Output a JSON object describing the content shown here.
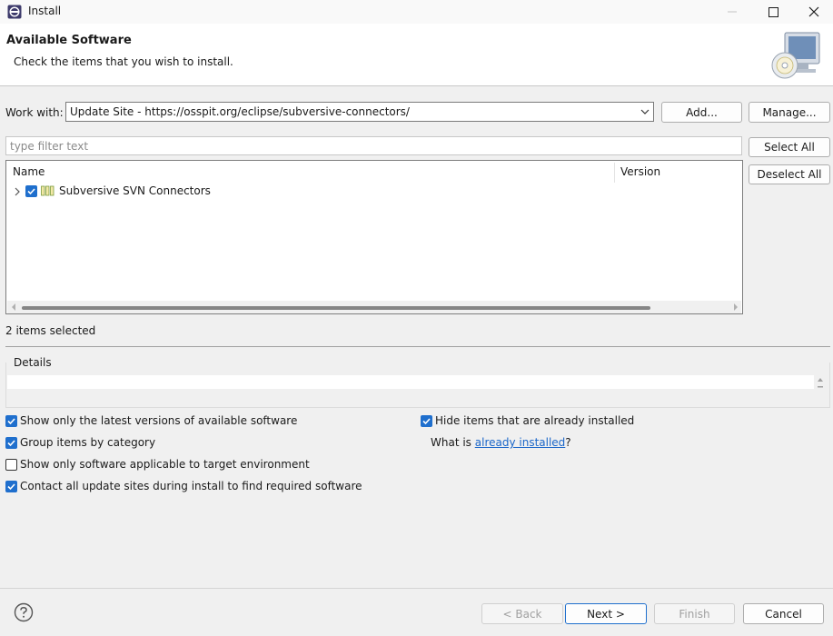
{
  "window": {
    "title": "Install",
    "icons": {
      "app": "eclipse-icon",
      "minimize": "minimize-icon",
      "maximize": "maximize-icon",
      "close": "close-icon"
    }
  },
  "header": {
    "title": "Available Software",
    "subtitle": "Check the items that you wish to install.",
    "image": "install-wizard-banner-icon"
  },
  "work_with": {
    "label": "Work with:",
    "value": "Update Site - https://osspit.org/eclipse/subversive-connectors/",
    "add_label": "Add...",
    "manage_label": "Manage..."
  },
  "filter": {
    "placeholder": "type filter text"
  },
  "selection_buttons": {
    "select_all": "Select All",
    "deselect_all": "Deselect All"
  },
  "table": {
    "columns": [
      "Name",
      "Version"
    ],
    "rows": [
      {
        "name": "Subversive SVN Connectors",
        "version": "",
        "checked": true,
        "expandable": true,
        "icon": "category-icon"
      }
    ]
  },
  "status": "2 items selected",
  "details": {
    "label": "Details",
    "text": ""
  },
  "options": {
    "latest": {
      "label": "Show only the latest versions of available software",
      "checked": true
    },
    "group": {
      "label": "Group items by category",
      "checked": true
    },
    "target": {
      "label": "Show only software applicable to target environment",
      "checked": false
    },
    "contact": {
      "label": "Contact all update sites during install to find required software",
      "checked": true
    },
    "hide": {
      "label": "Hide items that are already installed",
      "checked": true
    },
    "what_is_prefix": "What is ",
    "what_is_link": "already installed",
    "what_is_suffix": "?"
  },
  "footer": {
    "help_icon": "help-icon",
    "back": "< Back",
    "next": "Next >",
    "finish": "Finish",
    "cancel": "Cancel"
  },
  "colors": {
    "accent": "#1f6fcd",
    "link": "#1a66c9"
  }
}
